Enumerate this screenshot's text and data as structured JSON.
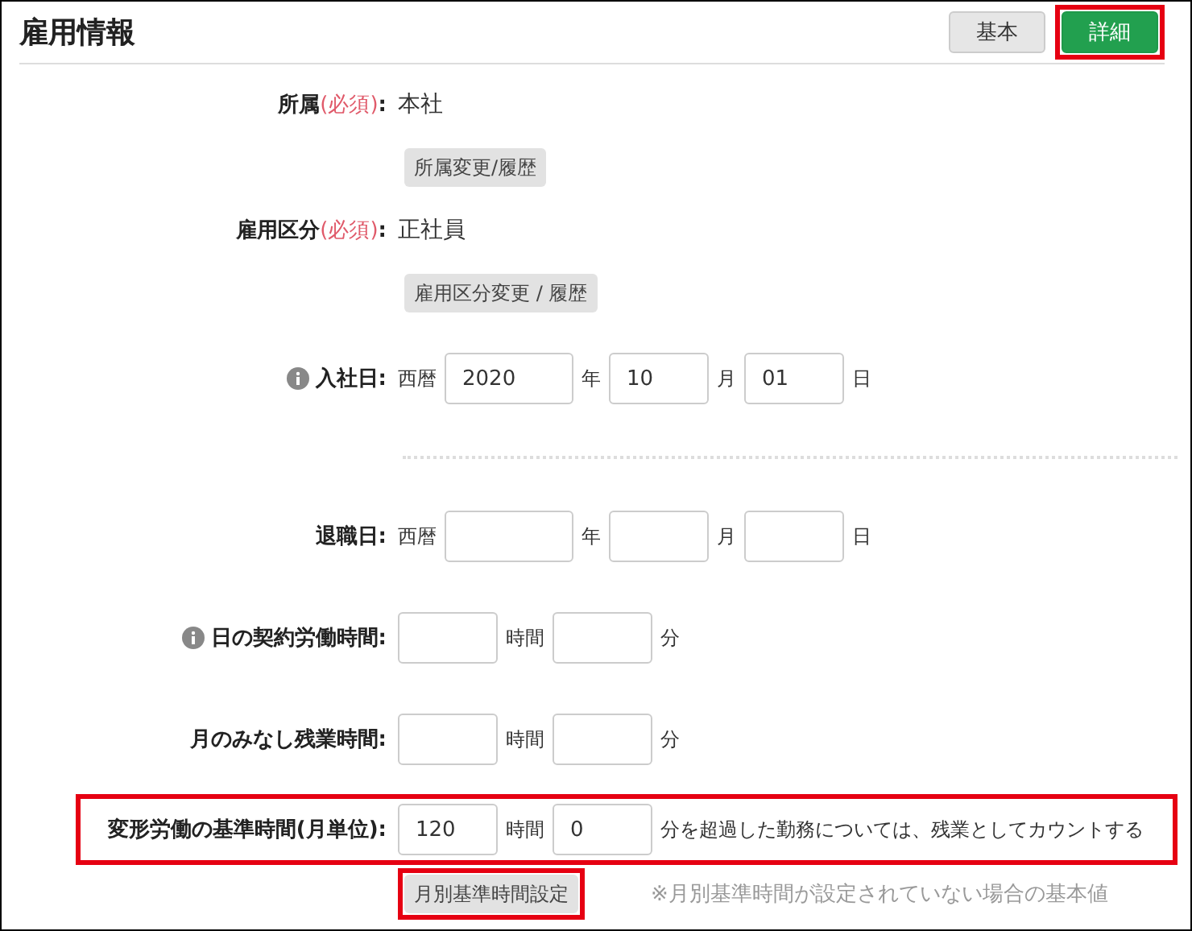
{
  "header": {
    "title": "雇用情報",
    "tabs": [
      {
        "label": "基本",
        "selected": false,
        "highlighted": false
      },
      {
        "label": "詳細",
        "selected": true,
        "highlighted": true
      }
    ]
  },
  "rows": [
    {
      "kind": "text",
      "label": "所属",
      "required": "(必須)",
      "colon": ":",
      "value": "本社"
    },
    {
      "kind": "button",
      "label": "所属変更/履歴",
      "highlighted": false
    },
    {
      "kind": "text",
      "label": "雇用区分",
      "required": "(必須)",
      "colon": ":",
      "value": "正社員"
    },
    {
      "kind": "button",
      "label": "雇用区分変更 / 履歴",
      "highlighted": false
    },
    {
      "kind": "fields",
      "label": "入社日",
      "colon": ":",
      "info": true,
      "prefix": "西暦",
      "highlighted": false,
      "fields": [
        {
          "value": "2020",
          "unit": "年"
        },
        {
          "value": "10",
          "unit": "月"
        },
        {
          "value": "01",
          "unit": "日"
        }
      ]
    },
    {
      "kind": "divider"
    },
    {
      "kind": "fields",
      "label": "退職日",
      "colon": ":",
      "info": false,
      "prefix": "西暦",
      "highlighted": false,
      "fields": [
        {
          "unit": "年"
        },
        {
          "unit": "月"
        },
        {
          "unit": "日"
        }
      ]
    },
    {
      "kind": "fields",
      "label": "日の契約労働時間",
      "colon": ":",
      "info": true,
      "highlighted": false,
      "fields": [
        {
          "unit": "時間"
        },
        {
          "unit": "分"
        }
      ]
    },
    {
      "kind": "fields",
      "label": "月のみなし残業時間",
      "colon": ":",
      "info": false,
      "highlighted": false,
      "fields": [
        {
          "unit": "時間"
        },
        {
          "unit": "分"
        }
      ]
    },
    {
      "kind": "fields",
      "label": "変形労働の基準時間(月単位)",
      "colon": ":",
      "info": false,
      "highlighted": true,
      "fields": [
        {
          "value": "120",
          "unit": "時間"
        },
        {
          "value": "0",
          "unit": "分を超過した勤務については、残業としてカウントする"
        }
      ]
    },
    {
      "kind": "button",
      "label": "月別基準時間設定",
      "highlighted": true,
      "note": "※月別基準時間が設定されていない場合の基本値"
    }
  ]
}
